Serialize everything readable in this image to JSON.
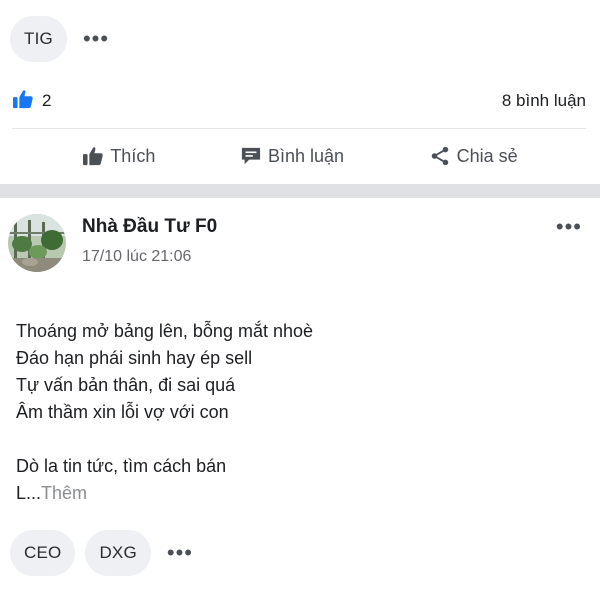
{
  "top_tags": {
    "items": [
      "TIG"
    ],
    "more": "•••"
  },
  "reactions": {
    "like_count": "2",
    "comments": "8 bình luận"
  },
  "actions": {
    "like": "Thích",
    "comment": "Bình luận",
    "share": "Chia sẻ"
  },
  "post": {
    "author": "Nhà Đầu Tư F0",
    "time": "17/10 lúc 21:06",
    "more": "•••",
    "lines": [
      "Thoáng mở bảng lên, bỗng mắt nhoè",
      "Đáo hạn phái sinh hay ép sell",
      "Tự vấn bản thân, đi sai quá",
      "Âm thầm xin lỗi vợ với con",
      "Dò la tin tức, tìm cách bán"
    ],
    "truncated_start": "L...",
    "see_more": "Thêm"
  },
  "bottom_tags": {
    "items": [
      "CEO",
      "DXG"
    ],
    "more": "•••"
  },
  "colors": {
    "like_blue": "#1877f2",
    "icon_gray": "#4b4f56",
    "separator": "#dfe1e4",
    "tag_bg": "#eef0f3"
  }
}
